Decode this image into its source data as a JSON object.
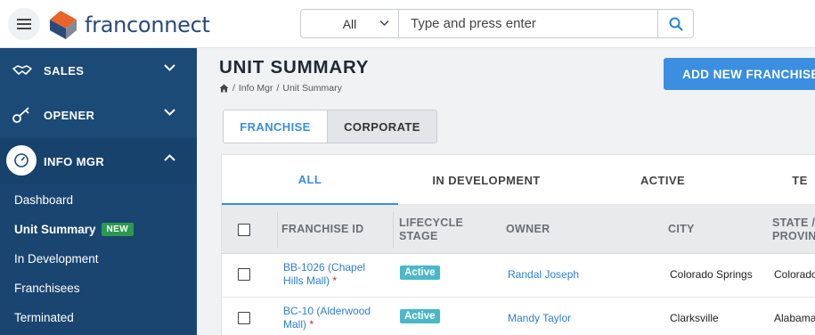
{
  "app": {
    "logo_text": "franconnect",
    "brand_color": "#1c4a77",
    "accent_color": "#3b8ee0"
  },
  "search": {
    "scope": "All",
    "placeholder": "Type and press enter"
  },
  "sidebar": {
    "sections": [
      {
        "label": "SALES",
        "icon": "handshake-icon",
        "expanded": false
      },
      {
        "label": "OPENER",
        "icon": "key-icon",
        "expanded": false
      },
      {
        "label": "INFO MGR",
        "icon": "gauge-icon",
        "expanded": true
      }
    ],
    "subitems": [
      {
        "label": "Dashboard"
      },
      {
        "label": "Unit Summary",
        "badge": "NEW",
        "active": true
      },
      {
        "label": "In Development"
      },
      {
        "label": "Franchisees"
      },
      {
        "label": "Terminated"
      }
    ]
  },
  "page": {
    "title": "UNIT SUMMARY",
    "breadcrumb": [
      "Info Mgr",
      "Unit Summary"
    ],
    "add_button": "ADD NEW FRANCHISE"
  },
  "toggle": {
    "franchise": "FRANCHISE",
    "corporate": "CORPORATE",
    "selected": "FRANCHISE"
  },
  "tabs": [
    {
      "label": "ALL",
      "active": true
    },
    {
      "label": "IN DEVELOPMENT"
    },
    {
      "label": "ACTIVE"
    },
    {
      "label": "TE"
    }
  ],
  "table": {
    "columns": {
      "franchise_id": "FRANCHISE ID",
      "lifecycle_line1": "LIFECYCLE",
      "lifecycle_line2": "STAGE",
      "owner": "OWNER",
      "city": "CITY",
      "state_line1": "STATE /",
      "state_line2": "PROVIN"
    },
    "rows": [
      {
        "franchise_id_line1": "BB-1026 (Chapel",
        "franchise_id_line2": "Hills Mall)",
        "required_mark": "*",
        "stage": "Active",
        "owner": "Randal Joseph",
        "city": "Colorado Springs",
        "state": "Colorado"
      },
      {
        "franchise_id_line1": "BC-10 (Alderwood",
        "franchise_id_line2": "Mall)",
        "required_mark": "*",
        "stage": "Active",
        "owner": "Mandy Taylor",
        "city": "Clarksville",
        "state": "Alabama"
      }
    ]
  }
}
